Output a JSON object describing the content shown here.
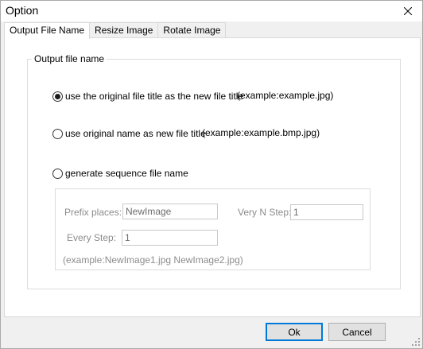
{
  "window": {
    "title": "Option",
    "close_label": "✕"
  },
  "tabs": [
    {
      "label": "Output File Name",
      "active": true
    },
    {
      "label": "Resize Image",
      "active": false
    },
    {
      "label": "Rotate Image",
      "active": false
    }
  ],
  "output_group": {
    "legend": "Output file name",
    "options": [
      {
        "label": "use the original file title as the new file title",
        "example": "(example:example.jpg)",
        "selected": true
      },
      {
        "label": "use original name as new file title",
        "example": "(example:example.bmp.jpg)",
        "selected": false
      },
      {
        "label": "generate sequence file name",
        "example": "",
        "selected": false
      }
    ],
    "sequence": {
      "prefix_label": "Prefix places:",
      "prefix_value": "NewImage",
      "very_n_label": "Very N Step:",
      "very_n_value": "1",
      "every_step_label": "Every Step:",
      "every_step_value": "1",
      "example": "(example:NewImage1.jpg NewImage2.jpg)"
    }
  },
  "footer": {
    "ok_label": "Ok",
    "cancel_label": "Cancel"
  }
}
